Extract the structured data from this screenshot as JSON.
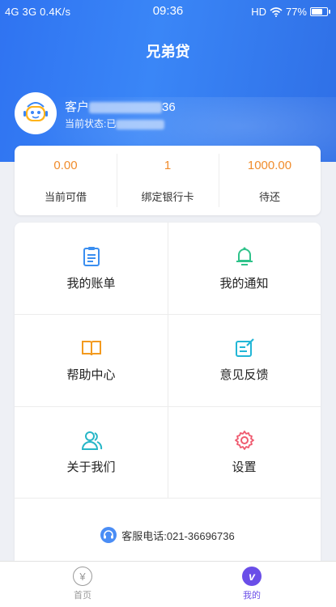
{
  "status_bar": {
    "left": "4G  3G  0.4K/s",
    "time": "09:36",
    "right": "HD",
    "battery": "77%",
    "battery_level": 0.77
  },
  "header": {
    "title": "兄弟贷"
  },
  "user": {
    "name_prefix": "客户",
    "name_suffix": "36",
    "status_prefix": "当前状态:已"
  },
  "stats": [
    {
      "value": "0.00",
      "label": "当前可借"
    },
    {
      "value": "1",
      "label": "绑定银行卡"
    },
    {
      "value": "1000.00",
      "label": "待还"
    }
  ],
  "menu": [
    {
      "label": "我的账单",
      "icon": "bill-icon",
      "color": "#3a8ef0"
    },
    {
      "label": "我的通知",
      "icon": "bell-icon",
      "color": "#2fc28a"
    },
    {
      "label": "帮助中心",
      "icon": "book-icon",
      "color": "#f39a1e"
    },
    {
      "label": "意见反馈",
      "icon": "edit-icon",
      "color": "#22b6d6"
    },
    {
      "label": "关于我们",
      "icon": "users-icon",
      "color": "#27b6c7"
    },
    {
      "label": "设置",
      "icon": "gear-icon",
      "color": "#ef5a6f"
    }
  ],
  "hotline": {
    "text": "客服电话:021-36696736"
  },
  "tabs": [
    {
      "label": "首页",
      "active": false
    },
    {
      "label": "我的",
      "active": true
    }
  ],
  "colors": {
    "primary": "#3a86f7",
    "accent": "#f08c2c",
    "tab_active": "#6a4ee8"
  }
}
